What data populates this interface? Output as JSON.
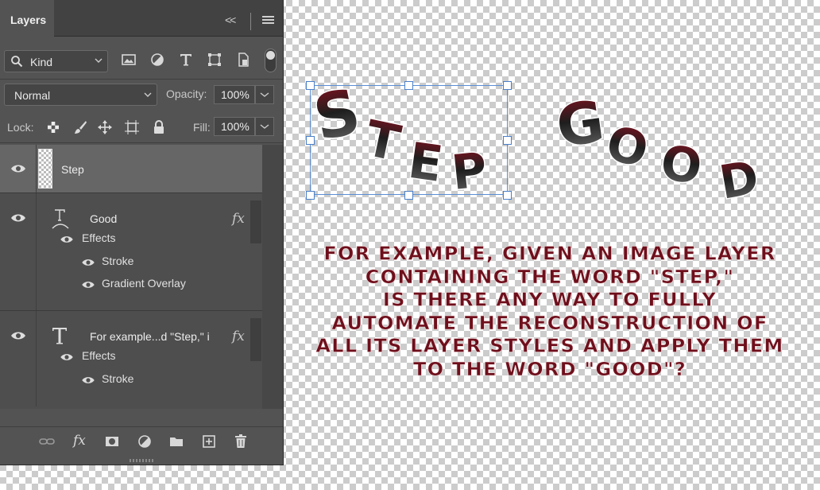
{
  "panel": {
    "tab_label": "Layers",
    "collapse_glyph": "<<",
    "filter": {
      "kind_label": "Kind"
    },
    "blend": {
      "mode": "Normal",
      "opacity_label": "Opacity:",
      "opacity_value": "100%"
    },
    "lock": {
      "lock_label": "Lock:",
      "fill_label": "Fill:",
      "fill_value": "100%"
    }
  },
  "layers": [
    {
      "name": "Step",
      "kind": "image",
      "selected": true
    },
    {
      "name": "Good",
      "kind": "warped-text",
      "fx": "fx",
      "effects_label": "Effects",
      "effects": [
        "Stroke",
        "Gradient Overlay"
      ]
    },
    {
      "name": "For example...d \"Step,\" i",
      "kind": "text",
      "fx": "fx",
      "effects_label": "Effects",
      "effects": [
        "Stroke"
      ]
    }
  ],
  "bottom_icons": [
    "link-icon",
    "fx-icon",
    "mask-icon",
    "adjustment-icon",
    "folder-icon",
    "new-layer-icon",
    "trash-icon"
  ],
  "canvas": {
    "word_step": "Step",
    "word_good": "Good",
    "caption_lines": [
      "FOR EXAMPLE, GIVEN AN IMAGE LAYER",
      "CONTAINING THE WORD \"STEP,\"",
      "IS THERE ANY WAY TO FULLY",
      "AUTOMATE THE RECONSTRUCTION OF",
      "ALL ITS LAYER STYLES AND APPLY THEM",
      "TO THE WORD \"GOOD\"?"
    ],
    "colors": {
      "text_dark_red": "#6e0f1c",
      "gradient_top": "#8a1020",
      "gradient_mid": "#1e1e1e",
      "gradient_bottom": "#707070",
      "selection_blue": "#4a7fc8"
    }
  }
}
